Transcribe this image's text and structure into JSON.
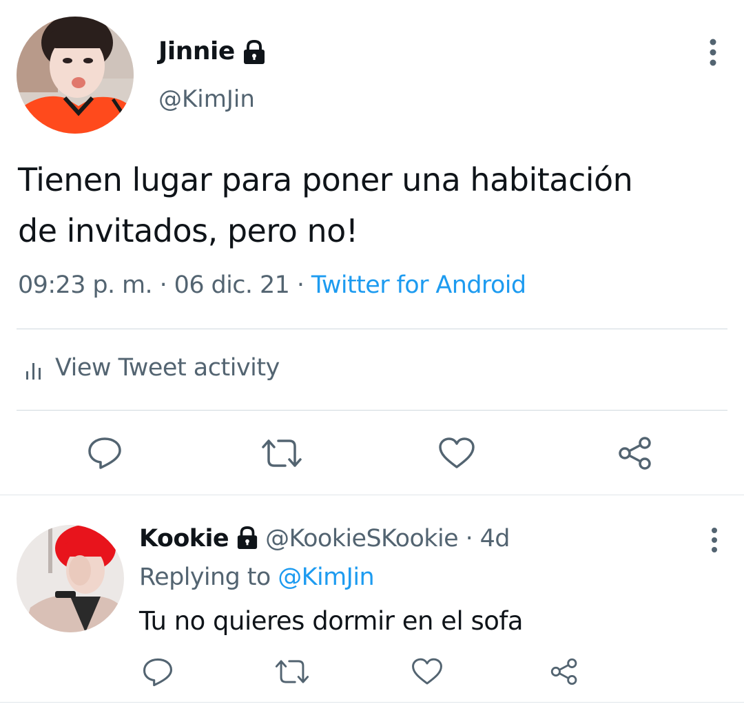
{
  "tweet": {
    "display_name": "Jinnie",
    "handle": "@KimJin",
    "text_line1": "Tienen lugar para poner una habitación",
    "text_line2": "de invitados, pero no!",
    "time": "09:23 p. m.",
    "separator": "·",
    "date": "06 dic. 21",
    "source": "Twitter for Android",
    "activity_label": "View Tweet activity",
    "protected": true
  },
  "reply": {
    "display_name": "Kookie",
    "handle": "@KookieSKookie",
    "separator": "·",
    "age": "4d",
    "replying_prefix": "Replying to",
    "replying_to": "@KimJin",
    "text": "Tu no quieres dormir en el sofa",
    "protected": true
  },
  "icons": {
    "lock": "lock-icon",
    "more": "more-vertical-icon",
    "activity": "bar-chart-icon",
    "reply": "reply-bubble-icon",
    "retweet": "retweet-icon",
    "like": "heart-icon",
    "share": "share-icon"
  },
  "colors": {
    "text": "#0f1419",
    "secondary": "#536471",
    "link": "#1d9bf0",
    "divider": "#cfd9de",
    "avatar_main_shirt": "#ff4a1c",
    "avatar_reply_hair": "#e8141c"
  }
}
